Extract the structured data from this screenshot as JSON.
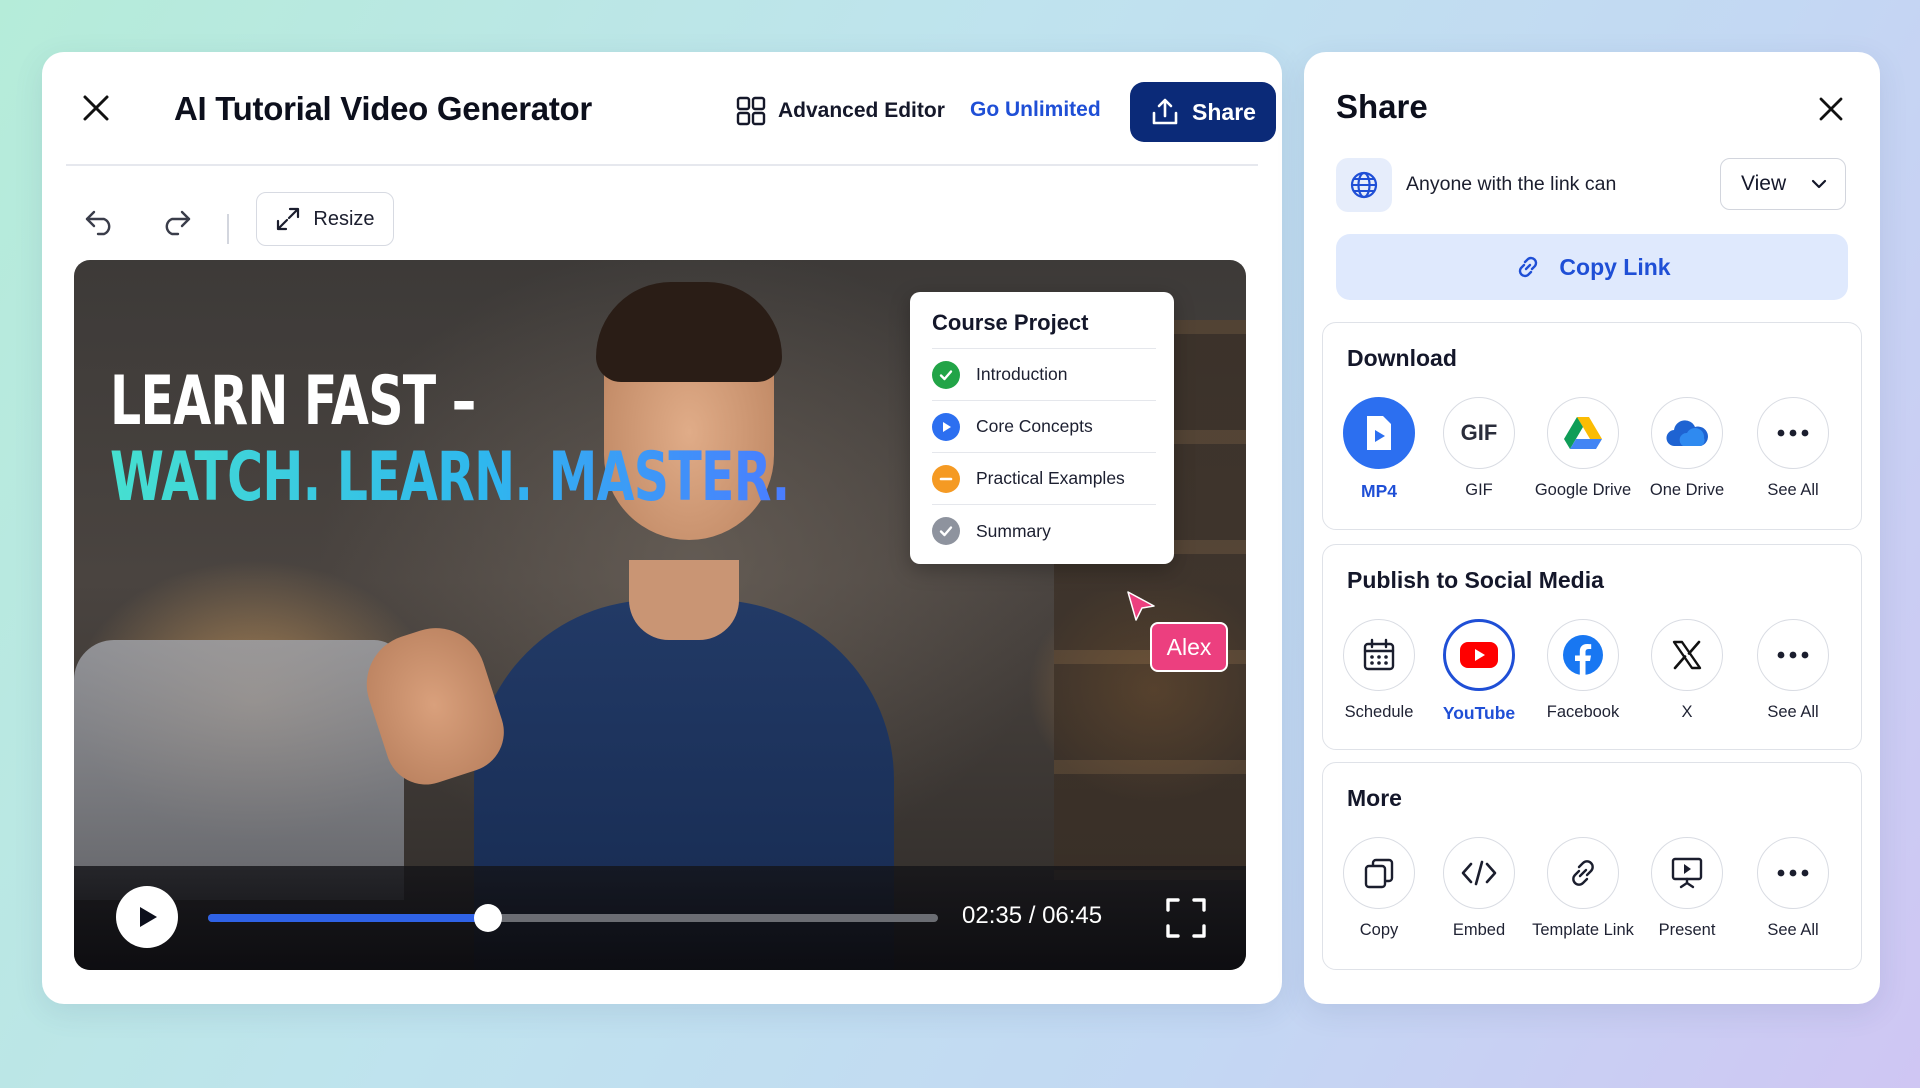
{
  "editor": {
    "title": "AI Tutorial Video Generator",
    "advanced_editor_label": "Advanced Editor",
    "go_unlimited_label": "Go Unlimited",
    "share_label": "Share",
    "resize_label": "Resize"
  },
  "video": {
    "headline_line1": "LEARN FAST –",
    "headline_line2": "WATCH. LEARN. MASTER.",
    "course_card": {
      "title": "Course Project",
      "items": [
        {
          "label": "Introduction",
          "status": "done",
          "color": "#22a447"
        },
        {
          "label": "Core Concepts",
          "status": "playing",
          "color": "#2c6ff0"
        },
        {
          "label": "Practical Examples",
          "status": "in-progress",
          "color": "#f59a23"
        },
        {
          "label": "Summary",
          "status": "pending",
          "color": "#8e939e"
        }
      ]
    },
    "collaborator_label": "Alex",
    "time_display": "02:35 / 06:45",
    "progress_fraction": 0.383
  },
  "share_panel": {
    "title": "Share",
    "link_access_text": "Anyone with the link can",
    "permission_value": "View",
    "copy_link_label": "Copy Link",
    "download": {
      "title": "Download",
      "options": [
        {
          "label": "MP4",
          "icon": "mp4-file-icon",
          "selected": true
        },
        {
          "label": "GIF",
          "icon": "gif-icon"
        },
        {
          "label": "Google Drive",
          "icon": "google-drive-icon"
        },
        {
          "label": "One Drive",
          "icon": "onedrive-icon"
        },
        {
          "label": "See All",
          "icon": "more-dots-icon"
        }
      ]
    },
    "social": {
      "title": "Publish to Social Media",
      "options": [
        {
          "label": "Schedule",
          "icon": "calendar-icon"
        },
        {
          "label": "YouTube",
          "icon": "youtube-icon",
          "selected": true
        },
        {
          "label": "Facebook",
          "icon": "facebook-icon"
        },
        {
          "label": "X",
          "icon": "x-logo-icon"
        },
        {
          "label": "See All",
          "icon": "more-dots-icon"
        }
      ]
    },
    "more": {
      "title": "More",
      "options": [
        {
          "label": "Copy",
          "icon": "copy-icon"
        },
        {
          "label": "Embed",
          "icon": "code-icon"
        },
        {
          "label": "Template Link",
          "icon": "link-icon"
        },
        {
          "label": "Present",
          "icon": "present-icon"
        },
        {
          "label": "See All",
          "icon": "more-dots-icon"
        }
      ]
    }
  },
  "colors": {
    "brand_navy": "#0b2a78",
    "accent_blue": "#1f4fd6",
    "collaborator_pink": "#ec3f7f"
  }
}
